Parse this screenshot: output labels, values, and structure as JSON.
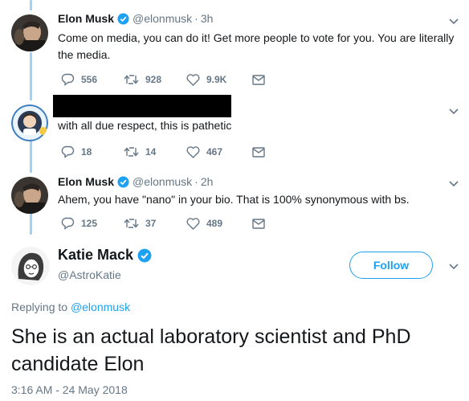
{
  "tweets": [
    {
      "name": "Elon Musk",
      "handle": "@elonmusk",
      "time": "3h",
      "text": "Come on media, you can do it! Get more people to vote for you. You are literally the media.",
      "replies": "556",
      "retweets": "928",
      "likes": "9.9K"
    },
    {
      "name": "",
      "handle": "",
      "time": "",
      "text": "with all due respect, this is pathetic",
      "replies": "18",
      "retweets": "14",
      "likes": "467"
    },
    {
      "name": "Elon Musk",
      "handle": "@elonmusk",
      "time": "2h",
      "text": "Ahem, you have \"nano\" in your bio. That is 100% synonymous with bs.",
      "replies": "125",
      "retweets": "37",
      "likes": "489"
    }
  ],
  "main_tweet": {
    "name": "Katie Mack",
    "handle": "@AstroKatie",
    "follow_label": "Follow",
    "replying_prefix": "Replying to",
    "replying_to": "@elonmusk",
    "text": "She is an actual laboratory scientist and PhD candidate Elon",
    "timestamp": "3:16 AM - 24 May 2018"
  },
  "colors": {
    "accent": "#1da1f2",
    "muted": "#657786",
    "thread_line": "#9fd3f5",
    "text": "#14171a"
  }
}
